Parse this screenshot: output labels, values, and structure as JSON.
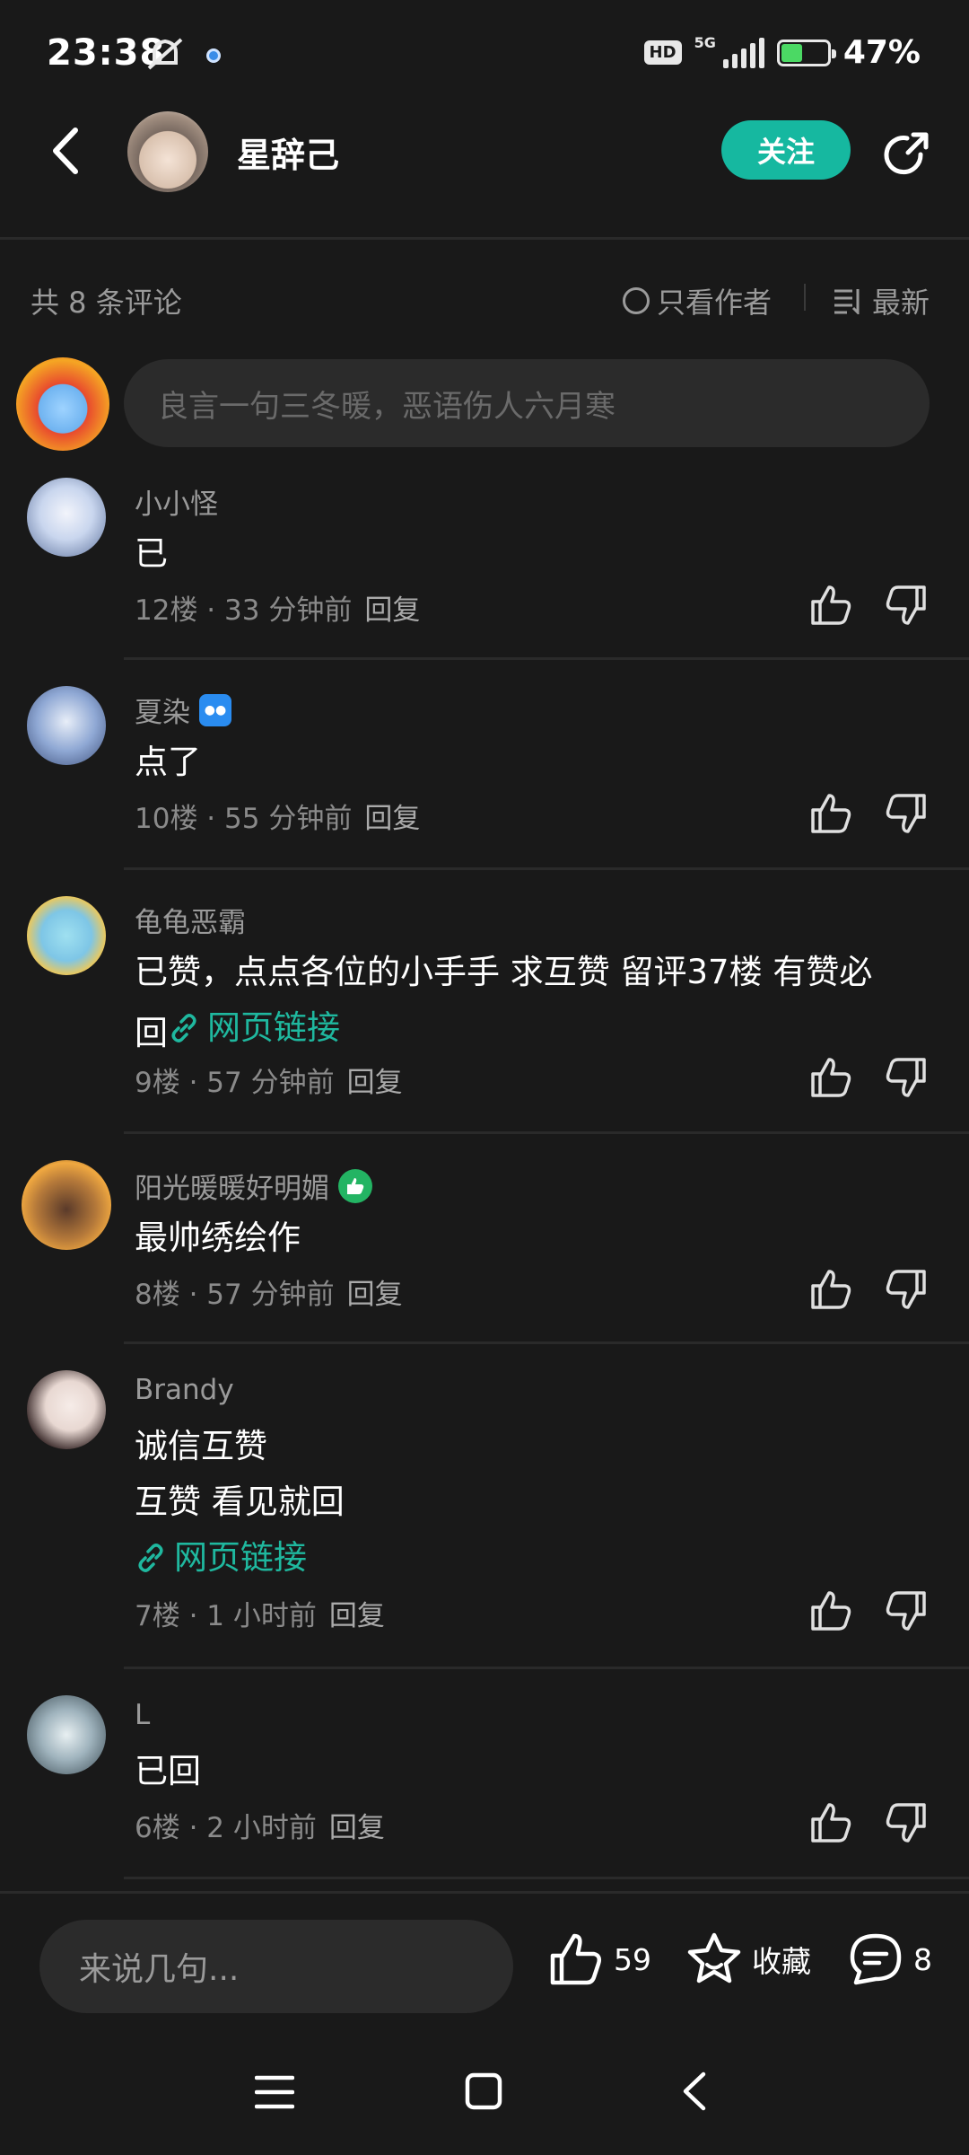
{
  "status_bar": {
    "time": "23:38",
    "network_badge": "HD",
    "network_type": "5G",
    "battery_percent": "47%",
    "battery_level": 0.47
  },
  "header": {
    "username": "星辞己",
    "follow_label": "关注"
  },
  "comments_bar": {
    "count_text": "共 8 条评论",
    "only_author_label": "只看作者",
    "sort_label": "最新"
  },
  "composer": {
    "placeholder": "良言一句三冬暖，恶语伤人六月寒"
  },
  "comments": [
    {
      "name": "小小怪",
      "lines": [
        "已"
      ],
      "floor": "12楼",
      "time": "33 分钟前",
      "reply": "回复",
      "avatar_color": "#c9d6ee"
    },
    {
      "name": "夏染",
      "lines": [
        "点了"
      ],
      "floor": "10楼",
      "time": "55 分钟前",
      "reply": "回复",
      "avatar_color": "#8fa8d4"
    },
    {
      "name": "龟龟恶霸",
      "lines": [
        "已赞，点点各位的小手手 求互赞 留评37楼  有赞必",
        "回"
      ],
      "link": "网页链接",
      "floor": "9楼",
      "time": "57 分钟前",
      "reply": "回复",
      "avatar_color": "#7ec6e6"
    },
    {
      "name": "阳光暖暖好明媚",
      "lines": [
        "最帅绣绘作"
      ],
      "floor": "8楼",
      "time": "57 分钟前",
      "reply": "回复",
      "avatar_color": "#b5793a"
    },
    {
      "name": "Brandy",
      "lines": [
        "诚信互赞",
        "互赞 看见就回"
      ],
      "link": "网页链接",
      "floor": "7楼",
      "time": "1 小时前",
      "reply": "回复",
      "avatar_color": "#e8d8d2"
    },
    {
      "name": "L",
      "lines": [
        "已回"
      ],
      "floor": "6楼",
      "time": "2 小时前",
      "reply": "回复",
      "avatar_color": "#9fb3bd"
    }
  ],
  "bottom_bar": {
    "input_placeholder": "来说几句...",
    "like_count": "59",
    "favorite_label": "收藏",
    "comment_count": "8"
  },
  "colors": {
    "background": "#191919",
    "accent": "#16b8a0",
    "link": "#1fb89f"
  },
  "icons": [
    "back-arrow-icon",
    "share-icon",
    "circle-icon",
    "sort-icon",
    "thumb-up-icon",
    "thumb-down-icon",
    "link-icon",
    "star-icon",
    "comment-icon",
    "menu-icon",
    "home-icon",
    "nav-back-icon"
  ]
}
